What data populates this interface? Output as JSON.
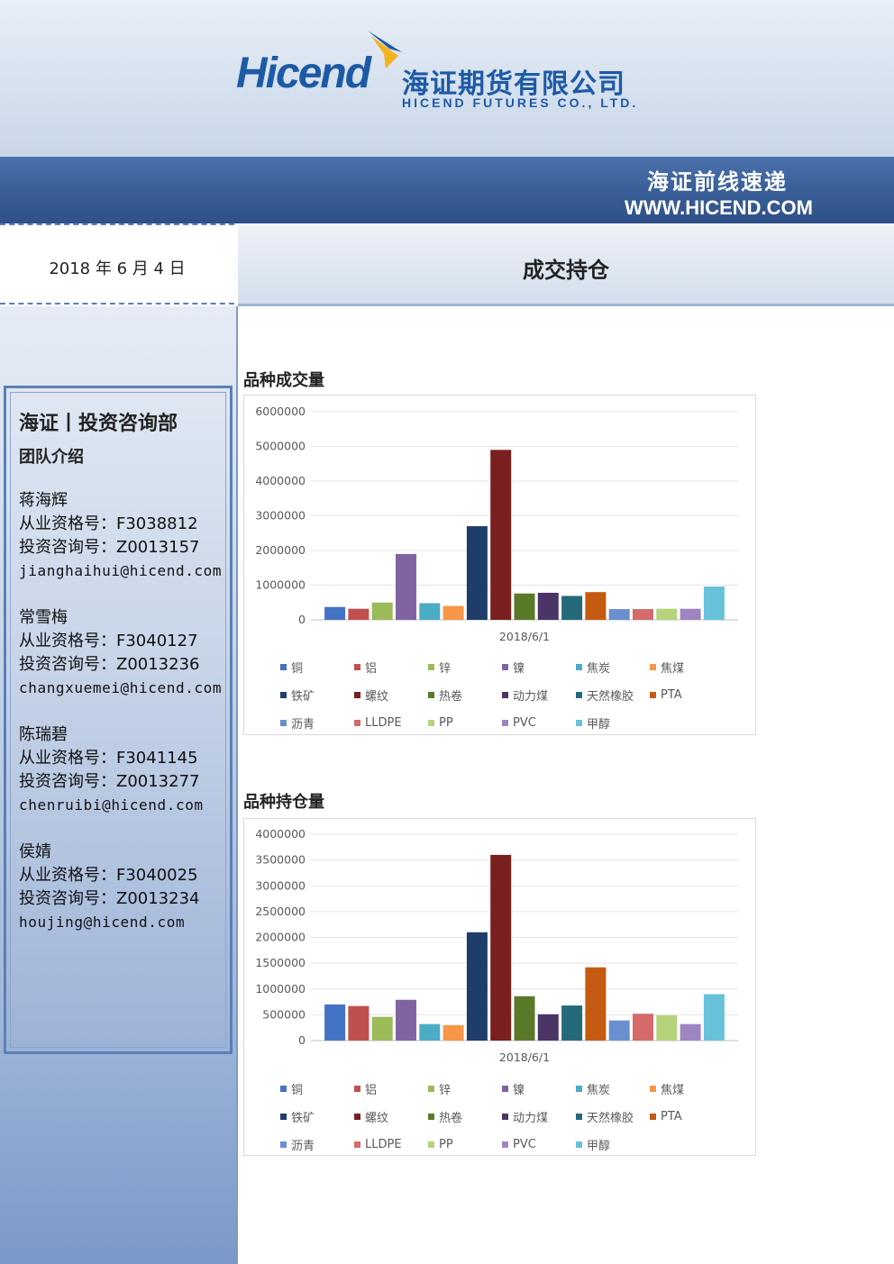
{
  "header": {
    "logo_en": "Hicend",
    "logo_cn": "海证期货有限公司",
    "logo_sub": "HICEND  FUTURES  CO.,  LTD.",
    "band_title": "海证前线速递",
    "band_url": "WWW.HICEND.COM"
  },
  "date": "2018 年 6 月 4 日",
  "page_title": "成交持仓",
  "sidebar": {
    "dept": "海证丨投资咨询部",
    "team_intro": "团队介绍",
    "members": [
      {
        "name": "蒋海辉",
        "qual": "从业资格号：F3038812",
        "advisory": "投资咨询号：Z0013157",
        "email": "jianghaihui@hicend.com"
      },
      {
        "name": "常雪梅",
        "qual": "从业资格号：F3040127",
        "advisory": "投资咨询号：Z0013236",
        "email": "changxuemei@hicend.com"
      },
      {
        "name": "陈瑞碧",
        "qual": "从业资格号：F3041145",
        "advisory": "投资咨询号：Z0013277",
        "email": "chenruibi@hicend.com"
      },
      {
        "name": "侯婧",
        "qual": "从业资格号：F3040025",
        "advisory": "投资咨询号：Z0013234",
        "email": "houjing@hicend.com"
      }
    ]
  },
  "colors": [
    "#4472c4",
    "#c0504d",
    "#9bbb59",
    "#8064a2",
    "#4bacc6",
    "#f79646",
    "#1f3d6b",
    "#7a1f1f",
    "#5a7a2a",
    "#4a3566",
    "#256a7a",
    "#c55a11",
    "#6a8fd0",
    "#d46a6a",
    "#b5d37a",
    "#9e85c1",
    "#67c2d9"
  ],
  "chart_data": [
    {
      "type": "bar",
      "title": "品种成交量",
      "categories": [
        "2018/6/1"
      ],
      "ylim": [
        0,
        6000000
      ],
      "yticks": [
        "6000000",
        "5000000",
        "4000000",
        "3000000",
        "2000000",
        "1000000",
        "0"
      ],
      "series": [
        {
          "name": "铜",
          "values": [
            370000
          ]
        },
        {
          "name": "铝",
          "values": [
            320000
          ]
        },
        {
          "name": "锌",
          "values": [
            500000
          ]
        },
        {
          "name": "镍",
          "values": [
            1900000
          ]
        },
        {
          "name": "焦炭",
          "values": [
            480000
          ]
        },
        {
          "name": "焦煤",
          "values": [
            400000
          ]
        },
        {
          "name": "铁矿",
          "values": [
            2700000
          ]
        },
        {
          "name": "螺纹",
          "values": [
            4900000
          ]
        },
        {
          "name": "热卷",
          "values": [
            760000
          ]
        },
        {
          "name": "动力煤",
          "values": [
            780000
          ]
        },
        {
          "name": "天然橡胶",
          "values": [
            690000
          ]
        },
        {
          "name": "PTA",
          "values": [
            800000
          ]
        },
        {
          "name": "沥青",
          "values": [
            310000
          ]
        },
        {
          "name": "LLDPE",
          "values": [
            310000
          ]
        },
        {
          "name": "PP",
          "values": [
            320000
          ]
        },
        {
          "name": "PVC",
          "values": [
            320000
          ]
        },
        {
          "name": "甲醇",
          "values": [
            960000
          ]
        }
      ]
    },
    {
      "type": "bar",
      "title": "品种持仓量",
      "categories": [
        "2018/6/1"
      ],
      "ylim": [
        0,
        4000000
      ],
      "yticks": [
        "4000000",
        "3500000",
        "3000000",
        "2500000",
        "2000000",
        "1500000",
        "1000000",
        "500000",
        "0"
      ],
      "series": [
        {
          "name": "铜",
          "values": [
            700000
          ]
        },
        {
          "name": "铝",
          "values": [
            670000
          ]
        },
        {
          "name": "锌",
          "values": [
            460000
          ]
        },
        {
          "name": "镍",
          "values": [
            790000
          ]
        },
        {
          "name": "焦炭",
          "values": [
            320000
          ]
        },
        {
          "name": "焦煤",
          "values": [
            300000
          ]
        },
        {
          "name": "铁矿",
          "values": [
            2100000
          ]
        },
        {
          "name": "螺纹",
          "values": [
            3600000
          ]
        },
        {
          "name": "热卷",
          "values": [
            860000
          ]
        },
        {
          "name": "动力煤",
          "values": [
            510000
          ]
        },
        {
          "name": "天然橡胶",
          "values": [
            680000
          ]
        },
        {
          "name": "PTA",
          "values": [
            1420000
          ]
        },
        {
          "name": "沥青",
          "values": [
            390000
          ]
        },
        {
          "name": "LLDPE",
          "values": [
            520000
          ]
        },
        {
          "name": "PP",
          "values": [
            490000
          ]
        },
        {
          "name": "PVC",
          "values": [
            320000
          ]
        },
        {
          "name": "甲醇",
          "values": [
            900000
          ]
        }
      ]
    }
  ]
}
